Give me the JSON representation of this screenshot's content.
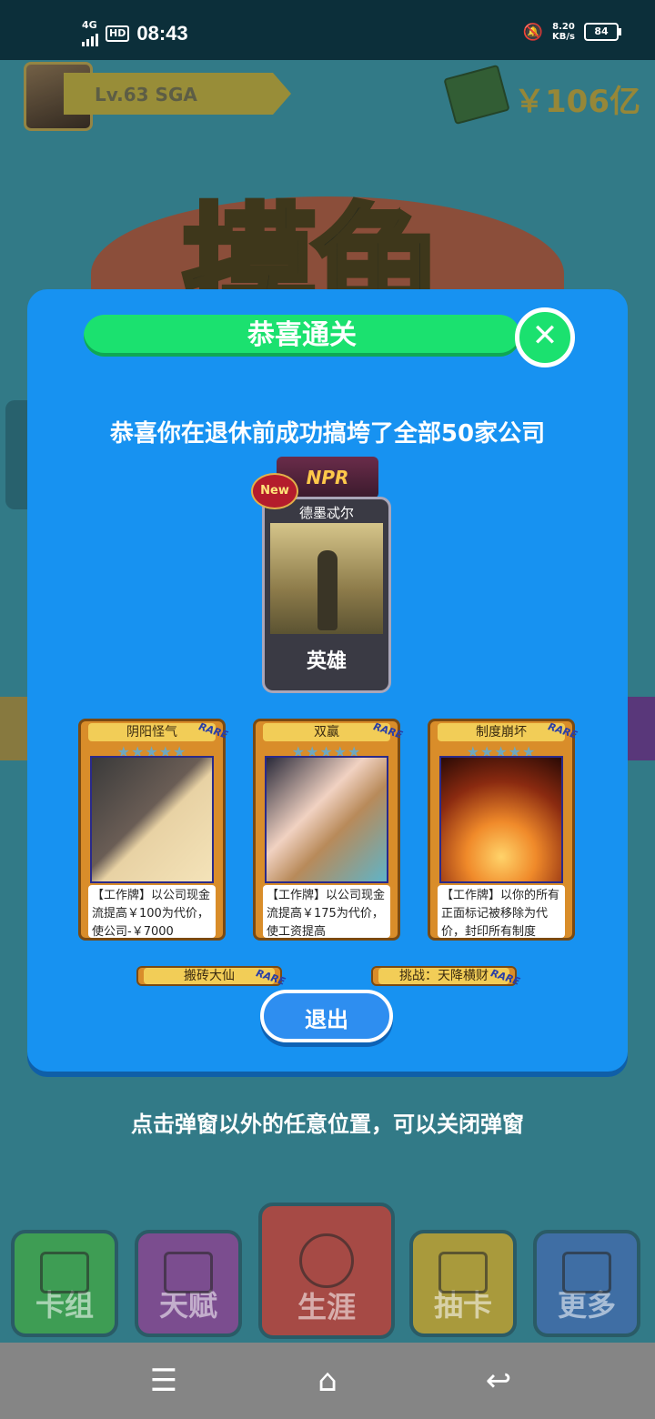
{
  "status_bar": {
    "network": "4G",
    "hd": "HD",
    "time": "08:43",
    "speed_value": "8.20",
    "speed_unit": "KB/s",
    "battery": "84"
  },
  "game": {
    "level": "Lv.63 SGA",
    "money": "￥106亿",
    "logo": "摸鱼"
  },
  "modal": {
    "title": "恭喜通关",
    "close_icon": "close-icon",
    "message": "恭喜你在退休前成功搞垮了全部50家公司",
    "hero": {
      "badge": "NPR",
      "new_label": "New",
      "name": "德墨忒尔",
      "rank": "英雄"
    },
    "cards": [
      {
        "name": "阴阳怪气",
        "rarity": "RARE",
        "stars": "★★★★★",
        "desc": "【工作牌】以公司现金流提高￥100为代价，使公司-￥7000"
      },
      {
        "name": "双赢",
        "rarity": "RARE",
        "stars": "★★★★★",
        "desc": "【工作牌】以公司现金流提高￥175为代价，使工资提高"
      },
      {
        "name": "制度崩坏",
        "rarity": "RARE",
        "stars": "★★★★★",
        "desc": "【工作牌】以你的所有正面标记被移除为代价，封印所有制度"
      }
    ],
    "mini_cards": [
      {
        "name": "搬砖大仙",
        "rarity": "RARE"
      },
      {
        "name": "挑战：天降横财",
        "rarity": "RARE"
      }
    ],
    "exit_label": "退出"
  },
  "hint": "点击弹窗以外的任意位置，可以关闭弹窗",
  "bottom_nav": [
    {
      "label": "卡组",
      "icon": "cards-icon"
    },
    {
      "label": "天赋",
      "icon": "scroll-icon"
    },
    {
      "label": "生涯",
      "icon": "medal-icon"
    },
    {
      "label": "抽卡",
      "icon": "ticket-icon"
    },
    {
      "label": "更多",
      "icon": "chart-icon"
    }
  ],
  "system_nav": {
    "menu": "☰",
    "home": "⌂",
    "back": "↩"
  }
}
